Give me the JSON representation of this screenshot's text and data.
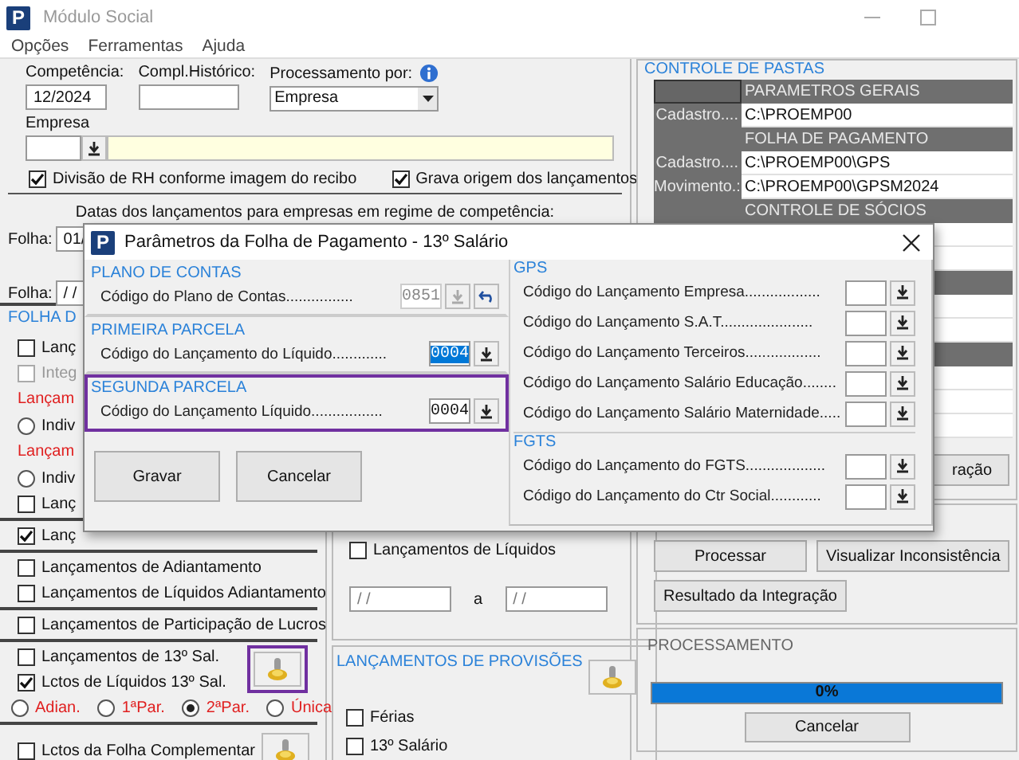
{
  "window": {
    "icon_letter": "P",
    "title": "Módulo Social"
  },
  "menu": [
    "Opções",
    "Ferramentas",
    "Ajuda"
  ],
  "header": {
    "competencia_label": "Competência:",
    "competencia": "12/2024",
    "compl_label": "Compl.Histórico:",
    "processamento_label": "Processamento por:",
    "processamento": "Empresa",
    "empresa_label": "Empresa",
    "options": [
      {
        "label": "Divisão de RH conforme imagem do recibo",
        "checked": true
      },
      {
        "label": "Grava origem dos lançamentos",
        "checked": true
      }
    ],
    "dates_caption": "Datas dos lançamentos para empresas em regime de competência:",
    "date_rows": [
      {
        "label": "Folha:",
        "value": "01/"
      },
      {
        "label": "Folha:",
        "value": "/ /"
      }
    ]
  },
  "payroll_panel": {
    "title": "FOLHA D",
    "groups": [
      {
        "items": [
          {
            "kind": "checkbox",
            "label": "Lanç",
            "checked": false,
            "disabled": false
          },
          {
            "kind": "checkbox",
            "label": "Integ",
            "checked": false,
            "disabled": true
          },
          {
            "kind": "caption",
            "label": "Lançam"
          },
          {
            "kind": "radio",
            "label": "Indiv",
            "selected": false
          },
          {
            "kind": "caption",
            "label": "Lançam"
          },
          {
            "kind": "radio",
            "label": "Indiv",
            "selected": false
          },
          {
            "kind": "checkbox",
            "label": "Lanç",
            "checked": false,
            "disabled": false
          }
        ]
      },
      {
        "items": [
          {
            "kind": "checkbox",
            "label": "Lanç",
            "checked": true,
            "disabled": false
          }
        ]
      },
      {
        "items": [
          {
            "kind": "checkbox",
            "label": "Lançamentos de Adiantamento",
            "checked": false,
            "disabled": false
          },
          {
            "kind": "checkbox",
            "label": "Lançamentos de Líquidos Adiantamento",
            "checked": false,
            "disabled": false
          }
        ]
      },
      {
        "items": [
          {
            "kind": "checkbox",
            "label": "Lançamentos de Participação de Lucros",
            "checked": false,
            "disabled": false
          }
        ]
      },
      {
        "items": [
          {
            "kind": "checkbox",
            "label": "Lançamentos de 13º Sal.",
            "checked": false,
            "disabled": false
          },
          {
            "kind": "checkbox",
            "label": "Lctos de Líquidos 13º Sal.",
            "checked": true,
            "disabled": false
          }
        ],
        "button_highlighted": true,
        "radios": [
          {
            "label": "Adian.",
            "selected": false
          },
          {
            "label": "1ªPar.",
            "selected": false
          },
          {
            "label": "2ªPar.",
            "selected": true
          },
          {
            "label": "Única",
            "selected": false
          }
        ]
      },
      {
        "items": [
          {
            "kind": "checkbox",
            "label": "Lctos da Folha Complementar",
            "checked": false,
            "disabled": false
          }
        ],
        "button_highlighted": false
      }
    ]
  },
  "liquidos_panel": {
    "checkbox": {
      "label": "Lançamentos de Líquidos",
      "checked": false
    },
    "from": "/ /",
    "separator": "a",
    "to": "/ /"
  },
  "provisoes_panel": {
    "title": "LANÇAMENTOS DE PROVISÕES",
    "items": [
      {
        "label": "Férias",
        "checked": false
      },
      {
        "label": "13º Salário",
        "checked": false
      }
    ]
  },
  "folders_panel": {
    "title": "CONTROLE DE PASTAS",
    "rows": [
      {
        "kind": "section",
        "title": "PARAMETROS GERAIS"
      },
      {
        "kind": "path",
        "label": "Cadastro....",
        "value": "C:\\PROEMP00"
      },
      {
        "kind": "section",
        "title": "FOLHA DE PAGAMENTO"
      },
      {
        "kind": "path",
        "label": "Cadastro....",
        "value": "C:\\PROEMP00\\GPS"
      },
      {
        "kind": "path",
        "label": "Movimento.:",
        "value": "C:\\PROEMP00\\GPSM2024"
      },
      {
        "kind": "section",
        "title": "CONTROLE DE SÓCIOS"
      }
    ],
    "button": "ração"
  },
  "actions_panel": {
    "buttons": [
      "Processar",
      "Visualizar Inconsistência",
      "Resultado da Integração"
    ]
  },
  "progress_panel": {
    "title": "PROCESSAMENTO",
    "level": 1,
    "progress_text": "0%",
    "button": "Cancelar"
  },
  "dialog": {
    "icon_letter": "P",
    "title": "Parâmetros da Folha de Pagamento - 13º Salário",
    "left_sections": [
      {
        "title": "PLANO DE CONTAS",
        "highlighted": false,
        "rows": [
          {
            "label": "Código do Plano de Contas................",
            "value": "0851",
            "disabled": true,
            "selected": false,
            "undo": true
          }
        ]
      },
      {
        "title": "PRIMEIRA PARCELA",
        "highlighted": false,
        "rows": [
          {
            "label": "Código do Lançamento do Líquido.............",
            "value": "0004",
            "disabled": false,
            "selected": true,
            "undo": false
          }
        ]
      },
      {
        "title": "SEGUNDA PARCELA",
        "highlighted": true,
        "rows": [
          {
            "label": "Código do Lançamento Líquido.................",
            "value": "0004",
            "disabled": false,
            "selected": false,
            "undo": false
          }
        ]
      }
    ],
    "right_sections": [
      {
        "title": "GPS",
        "rows": [
          "Código do Lançamento Empresa..................",
          "Código do Lançamento S.A.T......................",
          "Código do Lançamento Terceiros..................",
          "Código do Lançamento Salário Educação........",
          "Código do Lançamento Salário Maternidade....."
        ]
      },
      {
        "title": "FGTS",
        "rows": [
          "Código do Lançamento do FGTS...................",
          "Código do Lançamento do Ctr Social............"
        ]
      }
    ],
    "buttons": [
      "Gravar",
      "Cancelar"
    ]
  }
}
